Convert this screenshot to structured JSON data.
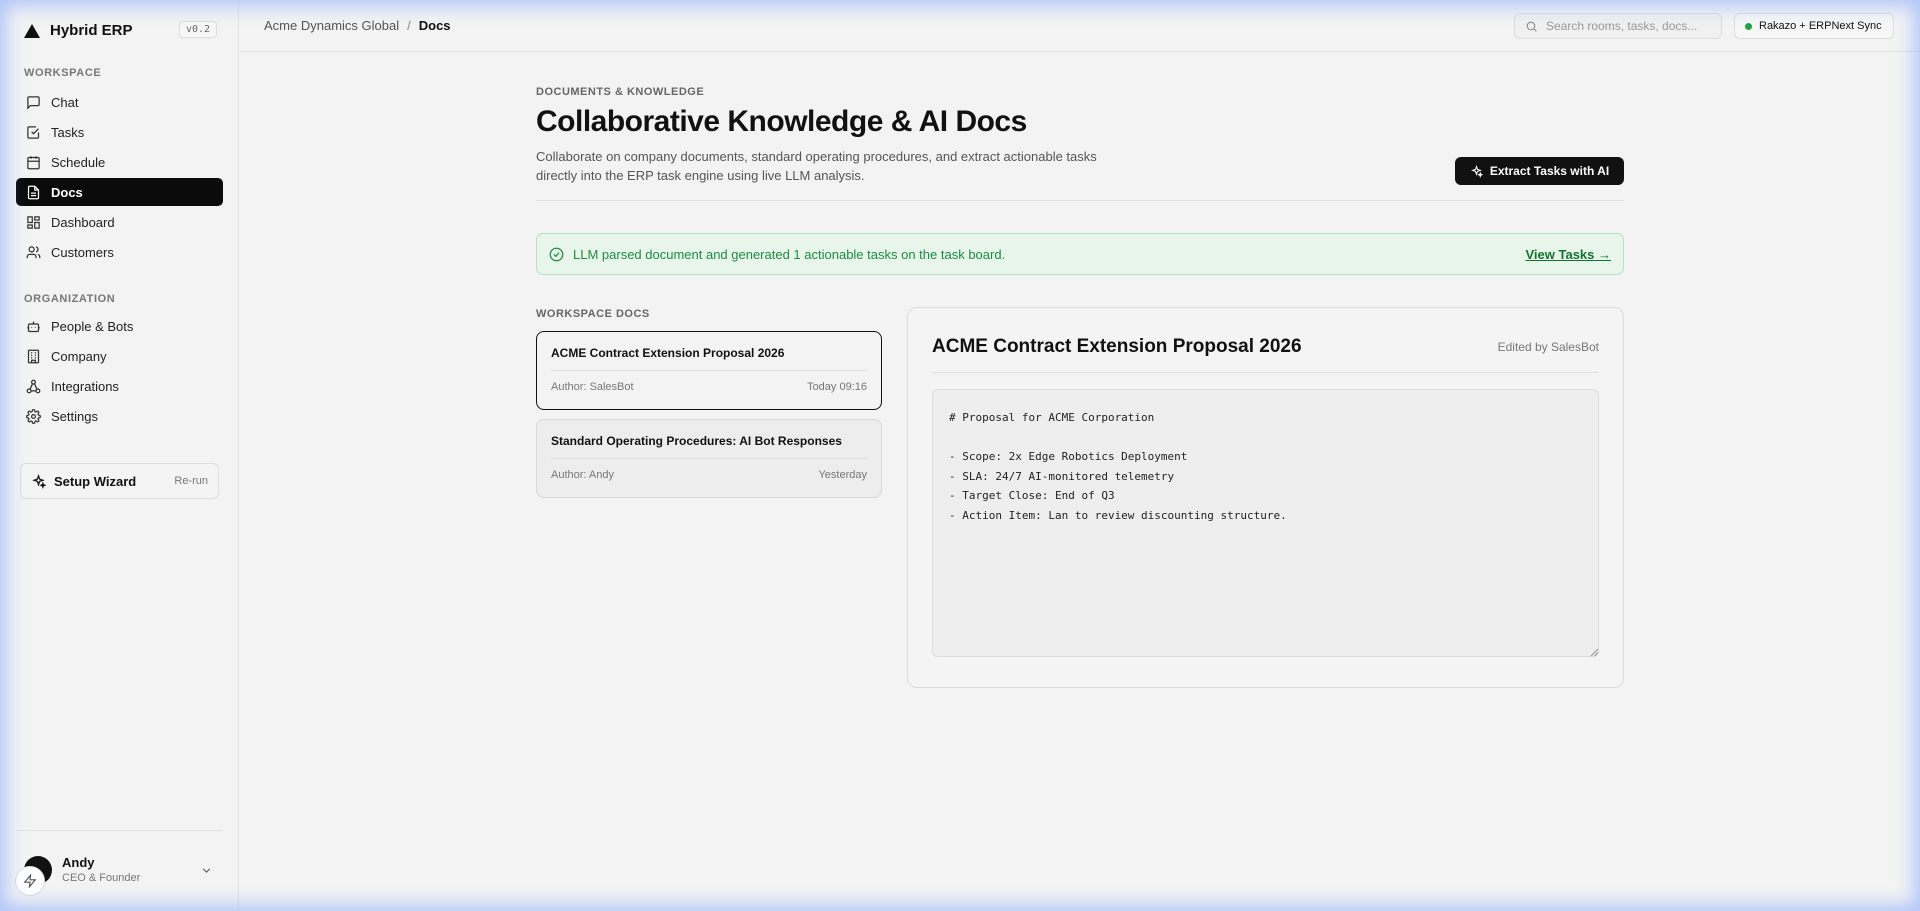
{
  "sidebar": {
    "brand": "Hybrid ERP",
    "version": "v0.2",
    "workspace_label": "WORKSPACE",
    "workspace_items": [
      {
        "label": "Chat",
        "icon": "chat-icon"
      },
      {
        "label": "Tasks",
        "icon": "checkbox-icon"
      },
      {
        "label": "Schedule",
        "icon": "calendar-icon"
      },
      {
        "label": "Docs",
        "icon": "document-icon",
        "active": true
      },
      {
        "label": "Dashboard",
        "icon": "dashboard-grid-icon"
      },
      {
        "label": "Customers",
        "icon": "users-icon"
      }
    ],
    "organization_label": "ORGANIZATION",
    "organization_items": [
      {
        "label": "People & Bots",
        "icon": "bot-icon"
      },
      {
        "label": "Company",
        "icon": "building-icon"
      },
      {
        "label": "Integrations",
        "icon": "network-icon"
      },
      {
        "label": "Settings",
        "icon": "gear-icon"
      }
    ],
    "setup": {
      "label": "Setup Wizard",
      "action": "Re-run"
    },
    "user": {
      "name": "Andy",
      "role": "CEO & Founder"
    }
  },
  "topbar": {
    "breadcrumb_org": "Acme Dynamics Global",
    "breadcrumb_sep": "/",
    "breadcrumb_current": "Docs",
    "search_placeholder": "Search rooms, tasks, docs...",
    "sync_label": "Rakazo + ERPNext Sync",
    "sync_color": "#22a045"
  },
  "main": {
    "eyebrow": "DOCUMENTS & KNOWLEDGE",
    "title": "Collaborative Knowledge & AI Docs",
    "description": "Collaborate on company documents, standard operating procedures, and extract actionable tasks directly into the ERP task engine using live LLM analysis.",
    "extract_button": "Extract Tasks with AI",
    "alert": {
      "message": "LLM parsed document and generated 1 actionable tasks on the task board.",
      "link": "View Tasks →"
    },
    "docs_label": "WORKSPACE DOCS",
    "docs": [
      {
        "title": "ACME Contract Extension Proposal 2026",
        "author": "Author: SalesBot",
        "time": "Today 09:16"
      },
      {
        "title": "Standard Operating Procedures: AI Bot Responses",
        "author": "Author: Andy",
        "time": "Yesterday"
      }
    ],
    "editor": {
      "title": "ACME Contract Extension Proposal 2026",
      "edited_by": "Edited by SalesBot",
      "content": "# Proposal for ACME Corporation\n\n- Scope: 2x Edge Robotics Deployment\n- SLA: 24/7 AI-monitored telemetry\n- Target Close: End of Q3\n- Action Item: Lan to review discounting structure."
    }
  }
}
